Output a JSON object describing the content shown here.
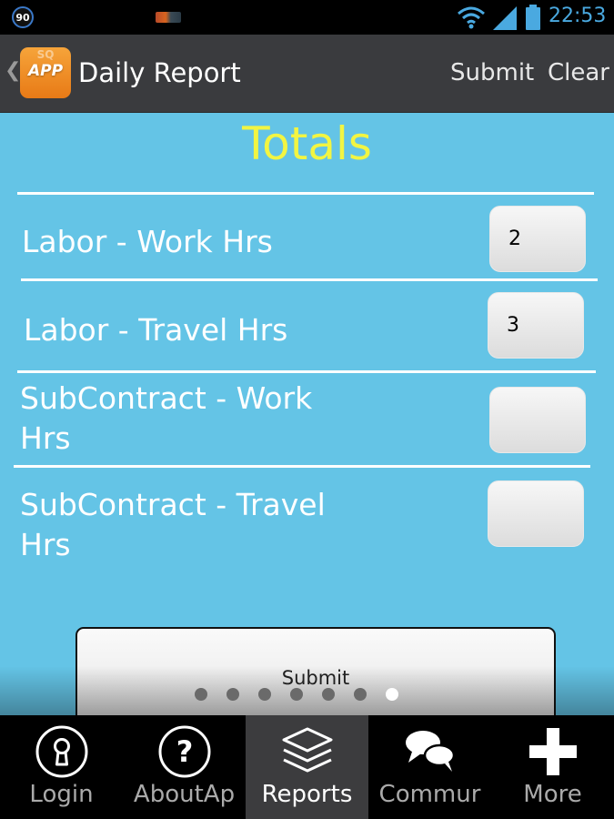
{
  "status_bar": {
    "notification_badge": "90",
    "time": "22:53"
  },
  "action_bar": {
    "app_icon_text": "APP",
    "app_icon_bg_text": "SQ",
    "title": "Daily Report",
    "submit_label": "Submit",
    "clear_label": "Clear"
  },
  "form": {
    "heading": "Totals",
    "rows": [
      {
        "label": "Labor - Work Hrs",
        "value": "2"
      },
      {
        "label": "Labor - Travel Hrs",
        "value": "3"
      },
      {
        "label_line1": "SubContract - Work",
        "label_line2": "Hrs",
        "value": ""
      },
      {
        "label_line1": "SubContract - Travel",
        "label_line2": "Hrs",
        "value": ""
      }
    ],
    "submit_button_label": "Submit"
  },
  "pager": {
    "page_count": 7,
    "active_index": 6
  },
  "tabs": [
    {
      "label": "Login",
      "icon": "keyhole-icon",
      "active": false
    },
    {
      "label": "AboutAp",
      "icon": "question-icon",
      "active": false
    },
    {
      "label": "Reports",
      "icon": "layers-icon",
      "active": true
    },
    {
      "label": "Commur",
      "icon": "chat-bubbles-icon",
      "active": false
    },
    {
      "label": "More",
      "icon": "plus-icon",
      "active": false
    }
  ],
  "colors": {
    "content_bg": "#64c4e6",
    "heading": "#f2f542",
    "status_time": "#4aa9e0",
    "action_bar": "#3a3b3e"
  }
}
